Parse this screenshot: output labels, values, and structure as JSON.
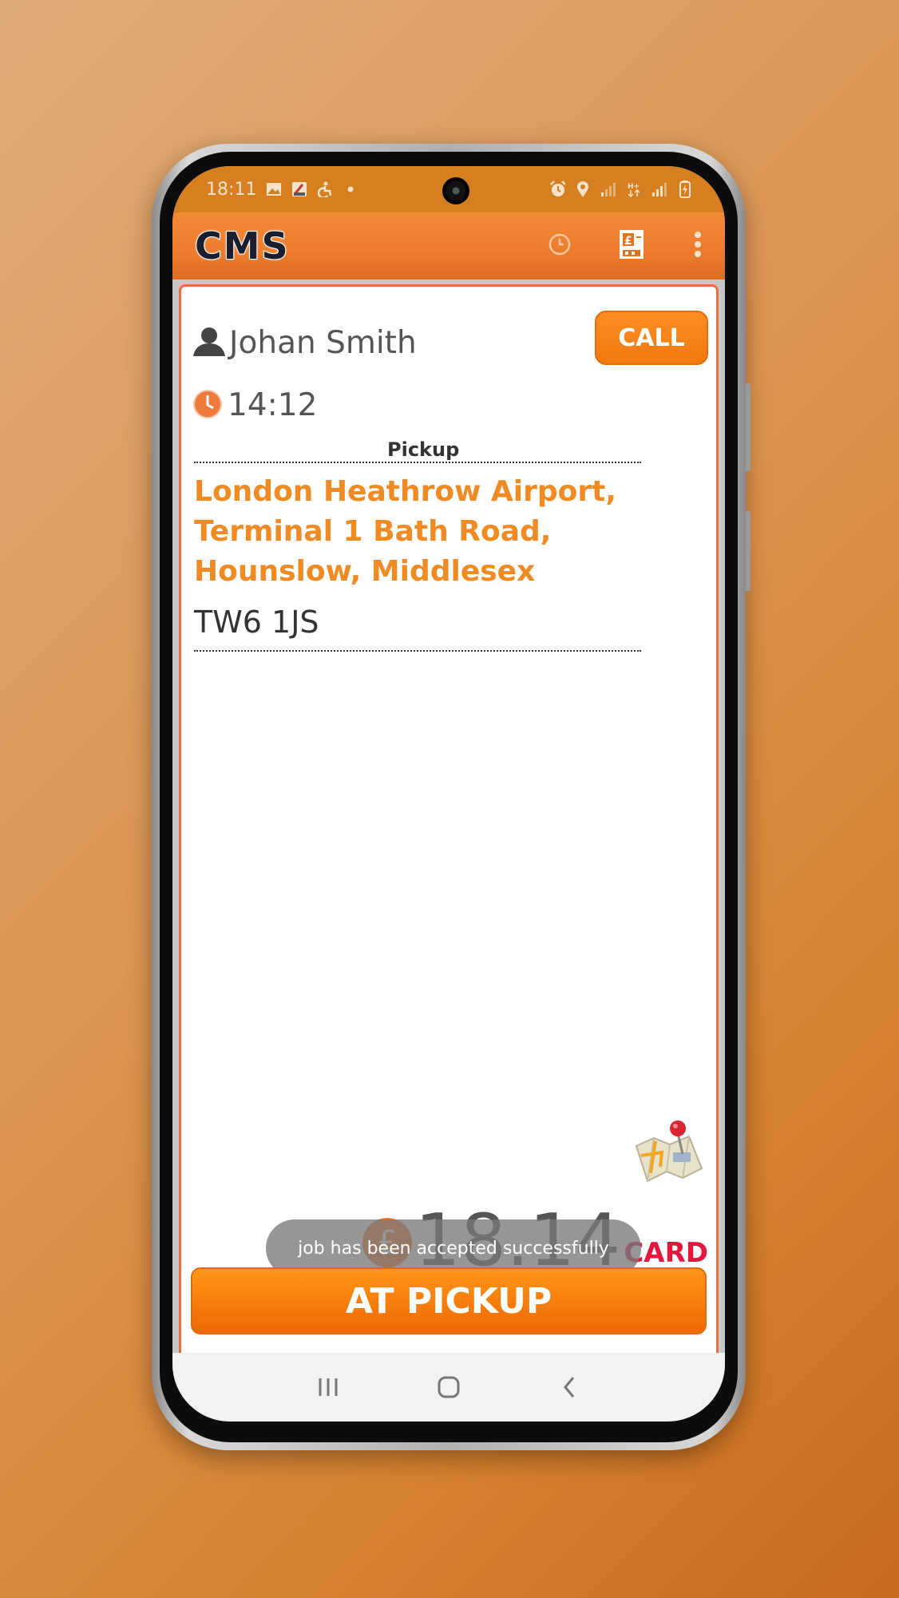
{
  "statusbar": {
    "time": "18:11",
    "left_icons": [
      "gallery-icon",
      "app-notification-icon",
      "accessibility-icon",
      "dot-icon"
    ],
    "right_icons": [
      "alarm-icon",
      "location-icon",
      "signal-icon",
      "data-icon",
      "signal-icon",
      "battery-icon"
    ]
  },
  "appbar": {
    "logo": "CMS",
    "actions": [
      "clock-icon",
      "fare-meter-icon",
      "more-vert-icon"
    ]
  },
  "job": {
    "passenger_name": "Johan Smith",
    "pickup_time": "14:12",
    "call_label": "CALL",
    "section_label": "Pickup",
    "address": "London Heathrow Airport, Terminal 1 Bath Road, Hounslow, Middlesex",
    "postcode": "TW6 1JS",
    "currency_symbol": "£",
    "fare": "18.14",
    "payment_type": "CARD",
    "action_label": "AT PICKUP"
  },
  "toast": {
    "message": "job has been accepted successfully"
  },
  "colors": {
    "brand_orange": "#f07a10",
    "address_orange": "#f08a22",
    "payment_red": "#e5153c",
    "statusbar": "#d57f20"
  },
  "navbar": {
    "buttons": [
      "recents-icon",
      "home-icon",
      "back-icon"
    ]
  }
}
